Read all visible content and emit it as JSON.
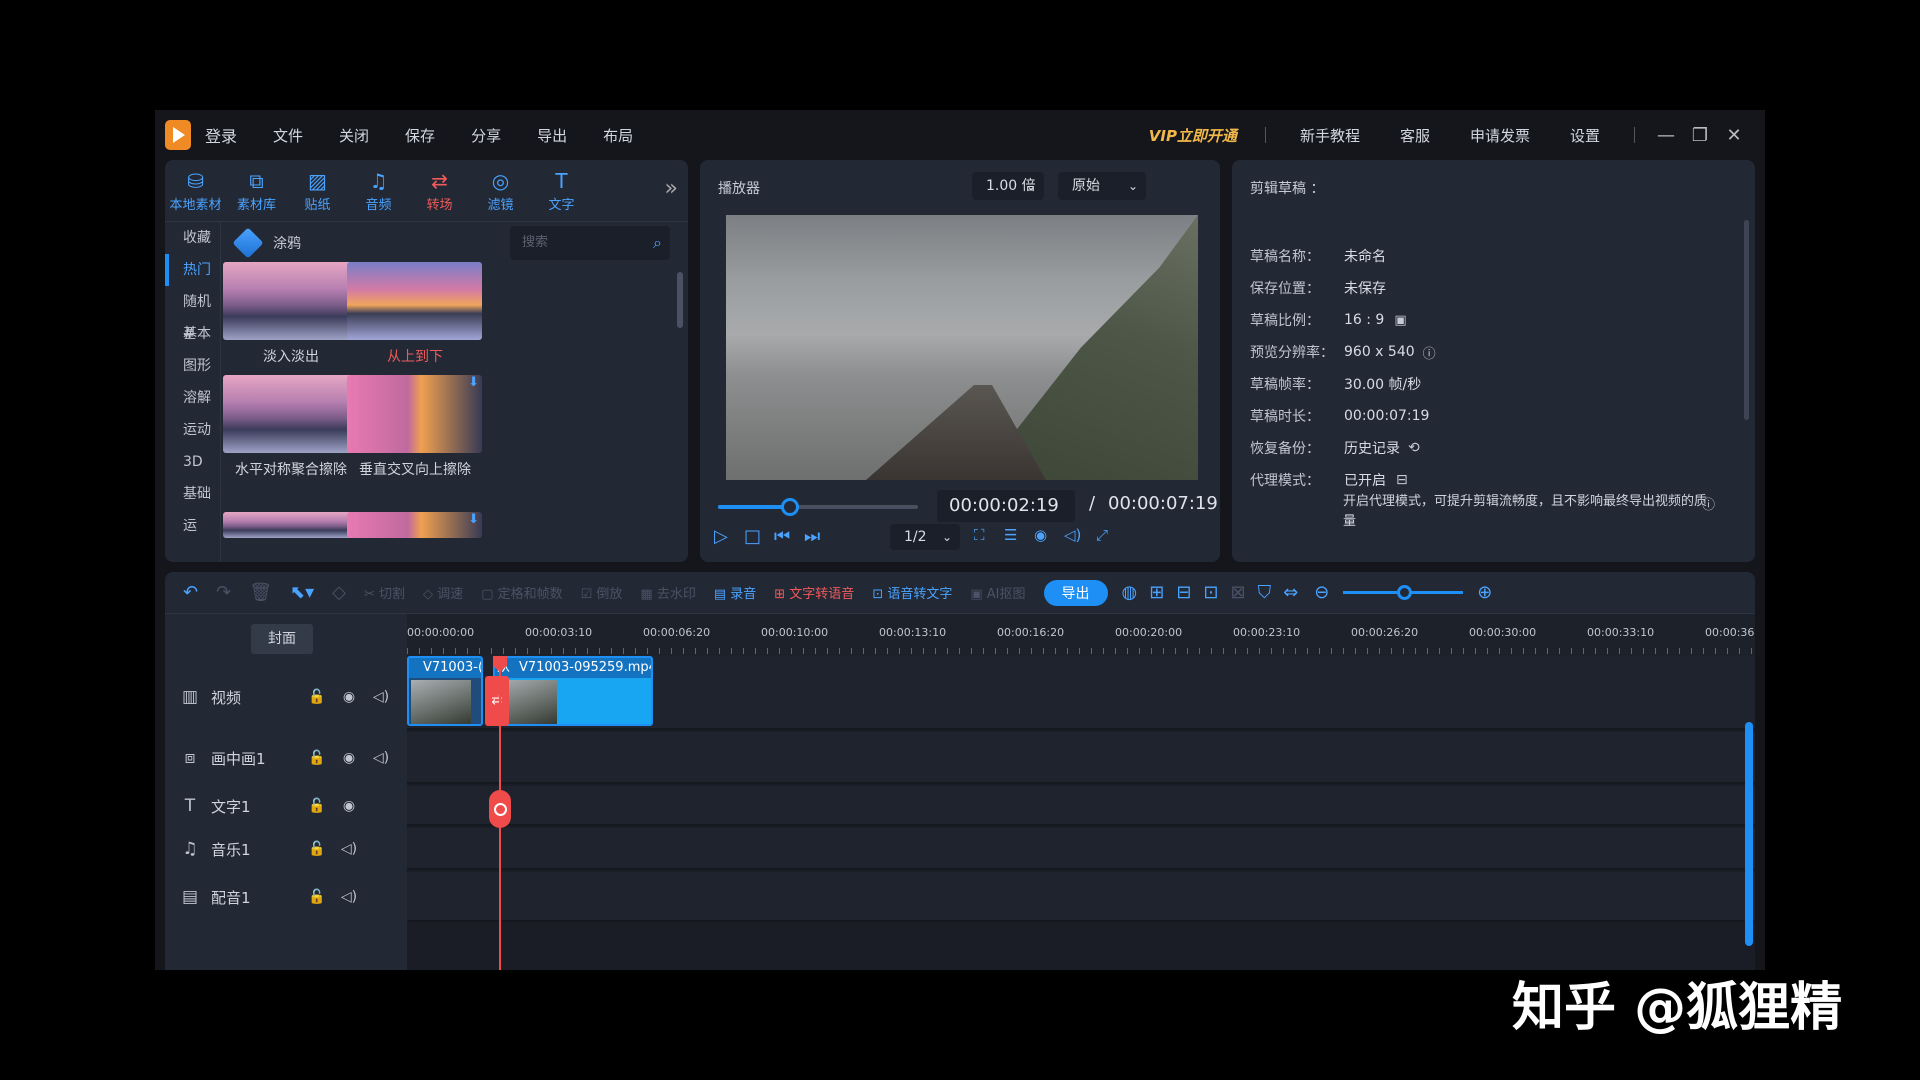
{
  "menubar": {
    "login": "登录",
    "items": [
      "文件",
      "关闭",
      "保存",
      "分享",
      "导出",
      "布局"
    ],
    "vip": "VIP立即开通",
    "right": [
      "新手教程",
      "客服",
      "申请发票",
      "设置"
    ],
    "win": [
      "—",
      "❐",
      "✕"
    ]
  },
  "media": {
    "tabs": [
      {
        "icon": "⛁",
        "label": "本地素材"
      },
      {
        "icon": "⧉",
        "label": "素材库"
      },
      {
        "icon": "▨",
        "label": "贴纸"
      },
      {
        "icon": "♫",
        "label": "音频"
      },
      {
        "icon": "⇄",
        "label": "转场"
      },
      {
        "icon": "◎",
        "label": "滤镜"
      },
      {
        "icon": "T",
        "label": "文字"
      }
    ],
    "more": "»",
    "categories": [
      "收藏",
      "热门",
      "随机#",
      "基本",
      "图形",
      "溶解",
      "运动",
      "3D",
      "基础运"
    ],
    "active_category": "热门",
    "header": "涂鸦",
    "search_placeholder": "搜索",
    "thumbs": [
      {
        "label": "淡入淡出"
      },
      {
        "label": "从上到下"
      },
      {
        "label": "水平对称聚合擦除"
      },
      {
        "label": "垂直交叉向上擦除"
      }
    ]
  },
  "player": {
    "title": "播放器",
    "speed": "1.00 倍",
    "aspect": "原始",
    "time_current": "00:00:02:19",
    "time_sep": "/",
    "time_total": "00:00:07:19",
    "progress": 0.36,
    "quality": "1/2",
    "controls": [
      "▷",
      "□",
      "⏮",
      "⏭"
    ],
    "tools": [
      "⛶",
      "☰",
      "◉",
      "◁)",
      "⤢"
    ]
  },
  "draft": {
    "title": "剪辑草稿 ：",
    "rows": [
      {
        "k": "草稿名称：",
        "v": "未命名"
      },
      {
        "k": "保存位置：",
        "v": "未保存"
      },
      {
        "k": "草稿比例：",
        "v": "16 : 9"
      },
      {
        "k": "预览分辨率：",
        "v": "960 x 540"
      },
      {
        "k": "草稿帧率：",
        "v": "30.00 帧/秒"
      },
      {
        "k": "草稿时长：",
        "v": "00:00:07:19"
      },
      {
        "k": "恢复备份：",
        "v": "历史记录"
      },
      {
        "k": "代理模式：",
        "v": "已开启"
      }
    ],
    "info": "开启代理模式，可提升剪辑流畅度，且不影响最终导出视频的质量"
  },
  "toolbar": {
    "undo": "↶",
    "redo": "↷",
    "delete": "🗑",
    "select": "⬉▾",
    "mark": "◇",
    "cut": "✂ 切割",
    "crop": "◇ 调速",
    "freeze": "▢ 定格和帧数",
    "rotate": "☑ 倒放",
    "mosaic": "▦ 去水印",
    "record": "录音",
    "tts": "文字转语音",
    "stt": "语音转文字",
    "ai": "AI抠图",
    "export": "导出",
    "icons": [
      "◍",
      "⊞",
      "⊟",
      "⊡",
      "⊠",
      "⛉",
      "⇔"
    ],
    "zoom_out": "⊖",
    "zoom_in": "⊕",
    "zoom_level": 0.45
  },
  "timeline": {
    "cover": "封面",
    "tracks": [
      {
        "icon": "▥",
        "name": "视频",
        "controls": [
          "🔓",
          "◉",
          "◁)"
        ]
      },
      {
        "icon": "⧈",
        "name": "画中画1",
        "controls": [
          "🔓",
          "◉",
          "◁)"
        ]
      },
      {
        "icon": "T",
        "name": "文字1",
        "controls": [
          "🔓",
          "◉"
        ]
      },
      {
        "icon": "♫",
        "name": "音乐1",
        "controls": [
          "🔓",
          "◁)"
        ]
      },
      {
        "icon": "▤",
        "name": "配音1",
        "controls": [
          "🔓",
          "◁)"
        ]
      }
    ],
    "ticks": [
      "00:00:00:00",
      "00:00:03:10",
      "00:00:06:20",
      "00:00:10:00",
      "00:00:13:10",
      "00:00:16:20",
      "00:00:20:00",
      "00:00:23:10",
      "00:00:26:20",
      "00:00:30:00",
      "00:00:33:10",
      "00:00:36"
    ],
    "clip1": "V71003-(",
    "clip_trans": "从",
    "clip2": "V71003-095259.mp4",
    "trans_icon": "⇄"
  },
  "watermark": "知乎 @狐狸精"
}
